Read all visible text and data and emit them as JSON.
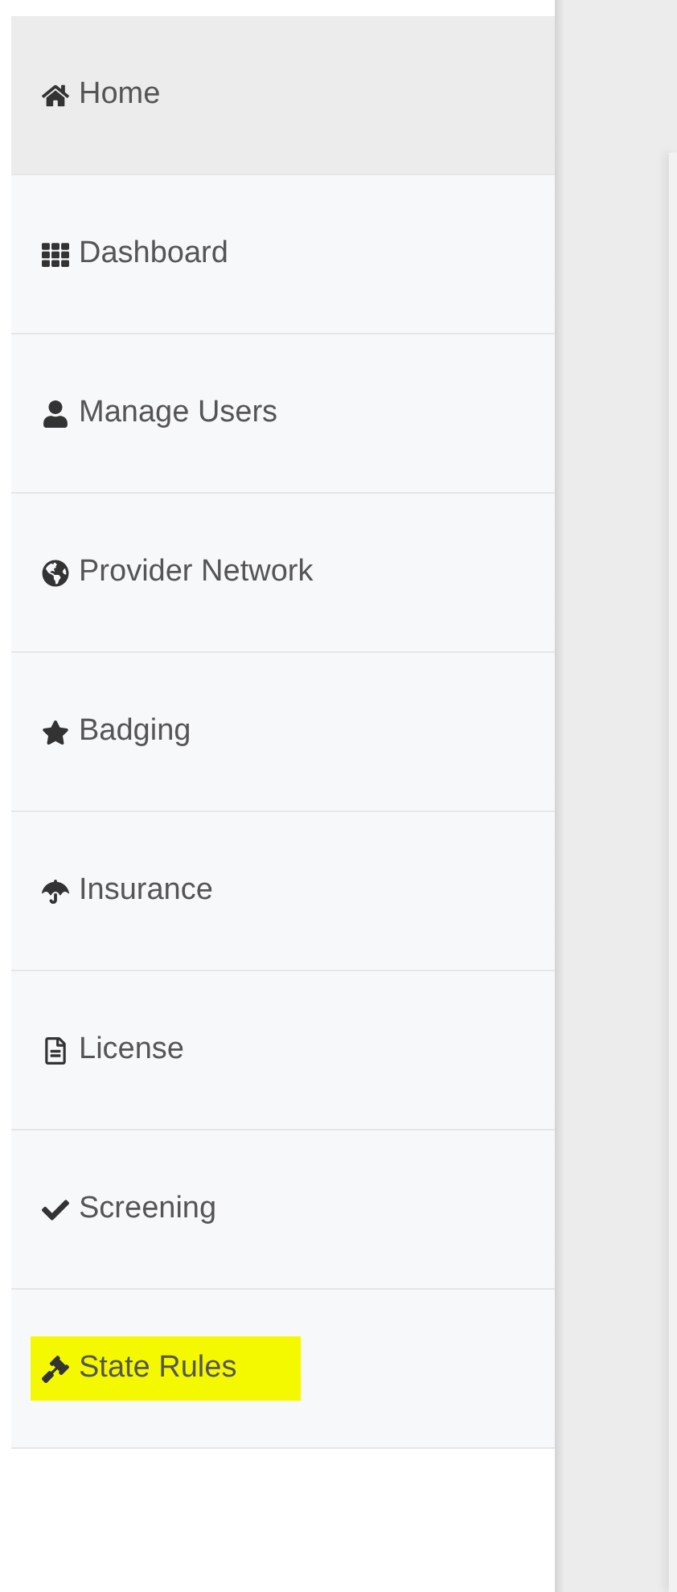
{
  "sidebar": {
    "items": [
      {
        "label": "Home",
        "selected": true,
        "highlighted": false
      },
      {
        "label": "Dashboard",
        "selected": false,
        "highlighted": false
      },
      {
        "label": "Manage Users",
        "selected": false,
        "highlighted": false
      },
      {
        "label": "Provider Network",
        "selected": false,
        "highlighted": false
      },
      {
        "label": "Badging",
        "selected": false,
        "highlighted": false
      },
      {
        "label": "Insurance",
        "selected": false,
        "highlighted": false
      },
      {
        "label": "License",
        "selected": false,
        "highlighted": false
      },
      {
        "label": "Screening",
        "selected": false,
        "highlighted": false
      },
      {
        "label": "State Rules",
        "selected": false,
        "highlighted": true
      }
    ]
  }
}
